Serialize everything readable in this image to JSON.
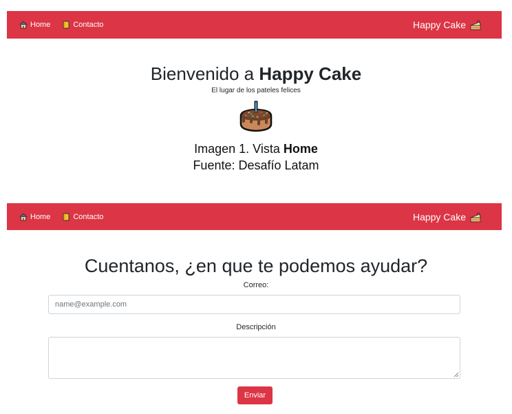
{
  "navbar_top": {
    "links": [
      {
        "label": "Home",
        "icon": "house-icon"
      },
      {
        "label": "Contacto",
        "icon": "notebook-icon"
      }
    ],
    "brand": {
      "label": "Happy Cake",
      "icon": "cake-slice-icon"
    },
    "color": "#dc3545"
  },
  "home": {
    "title_prefix": "Bienvenido a ",
    "title_bold": "Happy Cake",
    "subtitle": "El lugar de los pateles felices",
    "image_icon": "birthday-cake-icon",
    "caption_line1_prefix": "Imagen 1. Vista ",
    "caption_line1_bold": "Home",
    "caption_line2": "Fuente: Desafío Latam"
  },
  "navbar_bottom": {
    "links": [
      {
        "label": "Home",
        "icon": "house-icon"
      },
      {
        "label": "Contacto",
        "icon": "notebook-icon"
      }
    ],
    "brand": {
      "label": "Happy Cake",
      "icon": "cake-slice-icon"
    }
  },
  "contact": {
    "title": "Cuentanos, ¿en que te podemos ayudar?",
    "email_label": "Correo:",
    "email_placeholder": "name@example.com",
    "email_value": "",
    "description_label": "Descripción",
    "description_value": "",
    "submit_label": "Enviar"
  },
  "colors": {
    "primary": "#dc3545",
    "text": "#212529",
    "input_border": "#ced4da"
  }
}
